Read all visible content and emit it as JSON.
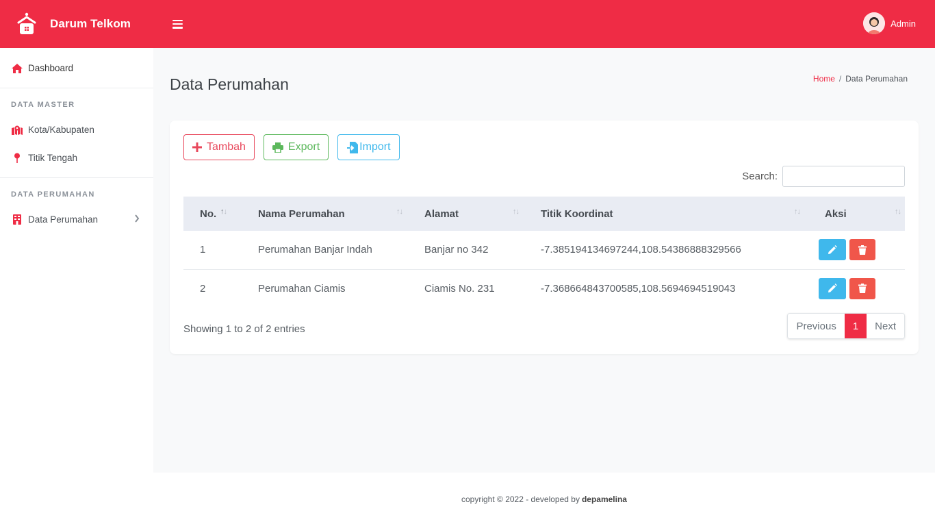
{
  "brand": {
    "name": "Darum Telkom"
  },
  "user": {
    "name": "Admin"
  },
  "sidebar": {
    "dashboard": "Dashboard",
    "section_master": "DATA MASTER",
    "items_master": [
      "Kota/Kabupaten",
      "Titik Tengah"
    ],
    "section_perumahan": "DATA PERUMAHAN",
    "perumahan_item": "Data Perumahan"
  },
  "page": {
    "title": "Data Perumahan",
    "breadcrumb": {
      "home": "Home",
      "sep": "/",
      "current": "Data Perumahan"
    }
  },
  "toolbar": {
    "tambah": "Tambah",
    "export": "Export",
    "import": "Import"
  },
  "search": {
    "label": "Search:",
    "value": ""
  },
  "table": {
    "headers": [
      "No.",
      "Nama Perumahan",
      "Alamat",
      "Titik Koordinat",
      "Aksi"
    ],
    "rows": [
      {
        "no": "1",
        "nama": "Perumahan Banjar Indah",
        "alamat": "Banjar no 342",
        "titik": "-7.385194134697244,108.54386888329566"
      },
      {
        "no": "2",
        "nama": "Perumahan Ciamis",
        "alamat": "Ciamis No. 231",
        "titik": "-7.368664843700585,108.5694694519043"
      }
    ]
  },
  "info": "Showing 1 to 2 of 2 entries",
  "pagination": {
    "previous": "Previous",
    "current": "1",
    "next": "Next"
  },
  "footer": {
    "text": "copyright © 2022 - developed by",
    "author": "depamelina"
  },
  "colors": {
    "primary": "#ef2c45",
    "info": "#3fb8ec",
    "success": "#5cb85c",
    "danger": "#f0564a"
  }
}
